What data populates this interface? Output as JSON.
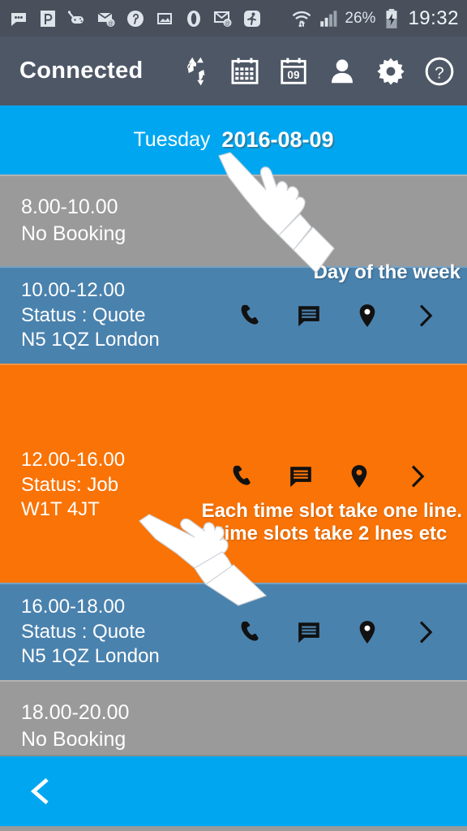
{
  "statusbar": {
    "icons": [
      {
        "name": "messages-icon"
      },
      {
        "name": "app-p-icon"
      },
      {
        "name": "game-controller-icon"
      },
      {
        "name": "mail-at-icon"
      },
      {
        "name": "pinterest-icon"
      },
      {
        "name": "photo-icon"
      },
      {
        "name": "opera-icon"
      },
      {
        "name": "mail-sync-icon"
      },
      {
        "name": "activity-running-icon"
      },
      {
        "name": "wifi-transfer-icon"
      },
      {
        "name": "signal-bars-icon"
      }
    ],
    "battery_percent": "26%",
    "battery_icon": "battery-charging-icon",
    "clock": "19:32"
  },
  "appbar": {
    "title": "Connected",
    "actions": [
      {
        "name": "sync-icon",
        "label": "Sync"
      },
      {
        "name": "calendar-month-icon",
        "label": "Month view"
      },
      {
        "name": "calendar-day-icon",
        "label": "09"
      },
      {
        "name": "person-icon",
        "label": "Account"
      },
      {
        "name": "gear-icon",
        "label": "Settings"
      },
      {
        "name": "help-icon",
        "label": "Help"
      }
    ],
    "calendar_day_number": "09"
  },
  "datebar": {
    "day_of_week": "Tuesday",
    "date": "2016-08-09"
  },
  "slots": [
    {
      "type": "empty",
      "time": "8.00-10.00",
      "status": "No Booking",
      "location": "",
      "has_actions": false
    },
    {
      "type": "quote",
      "time": "10.00-12.00",
      "status": "Status : Quote",
      "location": "N5 1QZ London",
      "has_actions": true
    },
    {
      "type": "job",
      "time": "12.00-16.00",
      "status": "Status: Job",
      "location": "W1T 4JT",
      "has_actions": true
    },
    {
      "type": "quote",
      "time": "16.00-18.00",
      "status": "Status : Quote",
      "location": "N5 1QZ London",
      "has_actions": true
    },
    {
      "type": "empty",
      "time": "18.00-20.00",
      "status": "No Booking",
      "location": "",
      "has_actions": false
    }
  ],
  "row_actions": [
    {
      "name": "phone-icon",
      "label": "Call"
    },
    {
      "name": "message-icon",
      "label": "Message"
    },
    {
      "name": "location-pin-icon",
      "label": "Map"
    },
    {
      "name": "chevron-right-icon",
      "label": "Open"
    }
  ],
  "annotations": {
    "day_of_week": "Day of the week",
    "slot_line1": "Each time slot take one line.",
    "slot_line2": "2 time slots take 2 lnes etc"
  },
  "bottombar": {
    "back_icon": "back-chevron-icon"
  },
  "colors": {
    "statusbar_bg": "#49505c",
    "appbar_bg": "#4e5766",
    "accent_blue": "#00a7f0",
    "quote_blue": "#4a82ae",
    "job_orange": "#f97306",
    "empty_gray": "#9a9a9a",
    "text_white": "#ffffff"
  }
}
